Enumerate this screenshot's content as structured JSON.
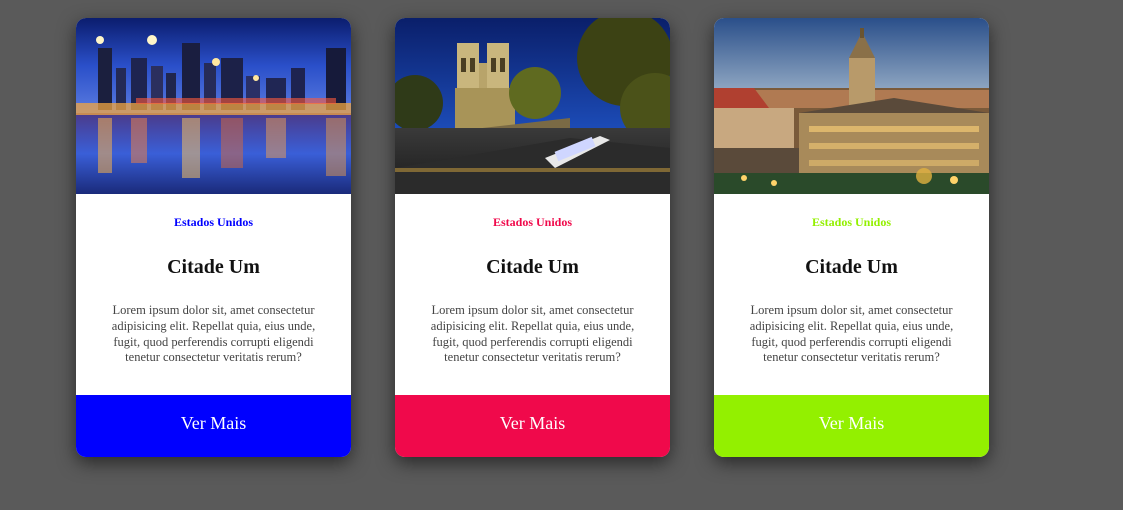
{
  "cards": [
    {
      "image": "city-night-skyline-photo",
      "country": "Estados Unidos",
      "title": "Citade Um",
      "description": "Lorem ipsum dolor sit, amet consectetur adipisicing elit. Repellat quia, eius unde, fugit, quod perferendis corrupti eligendi tenetur consectetur veritatis rerum?",
      "button_label": "Ver Mais",
      "accent": "#0000ff"
    },
    {
      "image": "notre-dame-river-photo",
      "country": "Estados Unidos",
      "title": "Citade Um",
      "description": "Lorem ipsum dolor sit, amet consectetur adipisicing elit. Repellat quia, eius unde, fugit, quod perferendis corrupti eligendi tenetur consectetur veritatis rerum?",
      "button_label": "Ver Mais",
      "accent": "#f0094b"
    },
    {
      "image": "munich-town-hall-photo",
      "country": "Estados Unidos",
      "title": "Citade Um",
      "description": "Lorem ipsum dolor sit, amet consectetur adipisicing elit. Repellat quia, eius unde, fugit, quod perferendis corrupti eligendi tenetur consectetur veritatis rerum?",
      "button_label": "Ver Mais",
      "accent": "#93f000"
    }
  ]
}
